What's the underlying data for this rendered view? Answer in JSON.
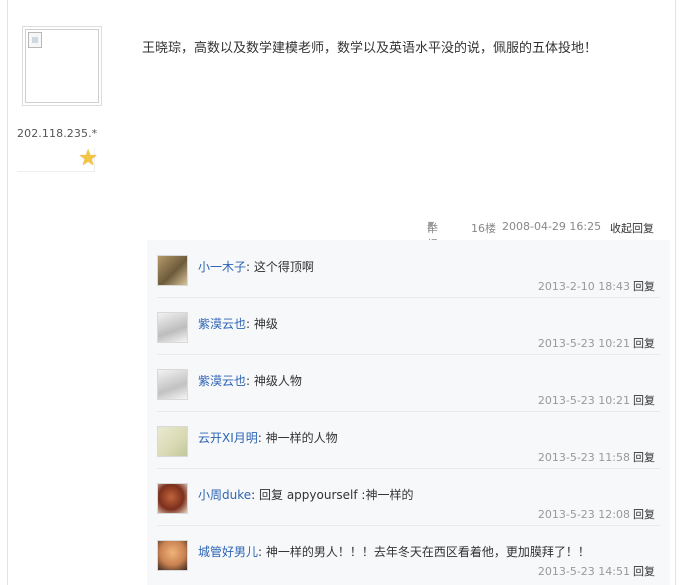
{
  "side": {
    "ip": "202.118.235.*"
  },
  "main": {
    "text": "王晓琮，高数以及数学建模老师，数学以及英语水平没的说，佩服的五体投地！"
  },
  "floor_bar": {
    "report": "举报",
    "floor": "16楼",
    "date": "2008-04-29 16:25",
    "collapse": "收起回复"
  },
  "replies": [
    {
      "user": "小一木子",
      "sep": ":",
      "text": "这个得顶啊",
      "date": "2013-2-10 18:43",
      "reply": "回复"
    },
    {
      "user": "紫漠云也",
      "sep": ":",
      "text": "神级",
      "date": "2013-5-23 10:21",
      "reply": "回复"
    },
    {
      "user": "紫漠云也",
      "sep": ":",
      "text": "神级人物",
      "date": "2013-5-23 10:21",
      "reply": "回复"
    },
    {
      "user": "云开XI月明",
      "sep": ":",
      "text": "神一样的人物",
      "date": "2013-5-23 11:58",
      "reply": "回复"
    },
    {
      "user": "小周duke",
      "sep": ":",
      "text": "回复 appyourself :神一样的",
      "date": "2013-5-23 12:08",
      "reply": "回复"
    },
    {
      "user": "城管好男儿",
      "sep": ":",
      "text": "神一样的男人！！！去年冬天在西区看着他，更加膜拜了！！",
      "date": "2013-5-23 14:51",
      "reply": "回复"
    }
  ],
  "icons": {
    "star": "star-icon",
    "report_caret": "caret-down-icon",
    "avatar": "broken-image-icon"
  }
}
